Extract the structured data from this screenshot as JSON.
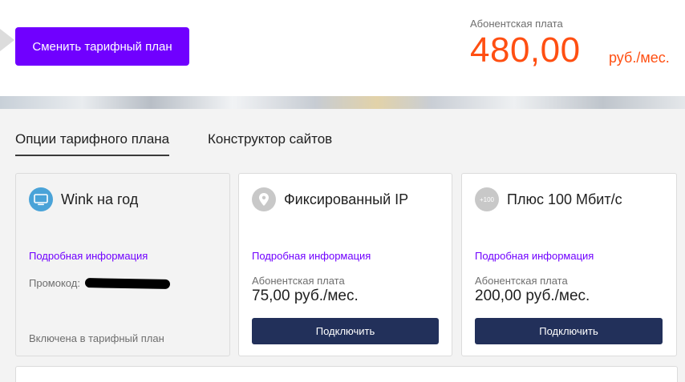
{
  "header": {
    "change_plan_button": "Сменить тарифный план",
    "subscription_label": "Абонентская плата",
    "price_value": "480,00",
    "price_unit": "руб./мес."
  },
  "tabs": [
    {
      "label": "Опции тарифного плана",
      "active": true
    },
    {
      "label": "Конструктор сайтов",
      "active": false
    }
  ],
  "options": [
    {
      "icon": "tv-icon",
      "title": "Wink на год",
      "details_link": "Подробная информация",
      "promo_label": "Промокод:",
      "status": "Включена в тарифный план"
    },
    {
      "icon": "location-pin-icon",
      "title": "Фиксированный IP",
      "details_link": "Подробная информация",
      "fee_label": "Абонентская плата",
      "fee_value": "75,00 руб./мес.",
      "button": "Подключить"
    },
    {
      "icon": "plus-100-icon",
      "icon_text": "+100",
      "title": "Плюс 100 Мбит/с",
      "details_link": "Подробная информация",
      "fee_label": "Абонентская плата",
      "fee_value": "200,00 руб./мес.",
      "button": "Подключить"
    }
  ],
  "colors": {
    "accent_purple": "#7000ff",
    "price_orange": "#ff4f12",
    "button_navy": "#22305a"
  }
}
